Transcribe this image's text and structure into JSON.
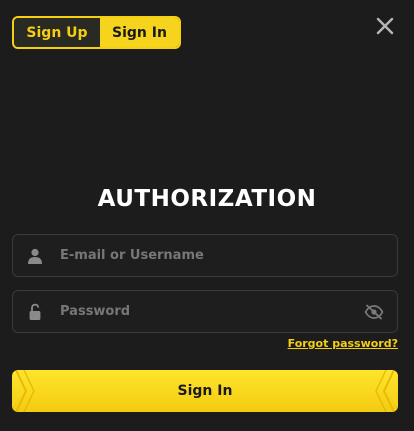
{
  "tabs": {
    "signup_label": "Sign Up",
    "signin_label": "Sign In"
  },
  "title": "AUTHORIZATION",
  "fields": {
    "email_placeholder": "E-mail or Username",
    "password_placeholder": "Password"
  },
  "forgot_label": "Forgot password?",
  "submit_label": "Sign In",
  "icons": {
    "close": "close-icon",
    "user": "user-icon",
    "lock": "lock-icon",
    "eye_off": "eye-off-icon"
  },
  "colors": {
    "accent": "#f5cf12",
    "background": "#1c1c1c",
    "field_border": "#3a3a3a",
    "placeholder": "#777777"
  }
}
